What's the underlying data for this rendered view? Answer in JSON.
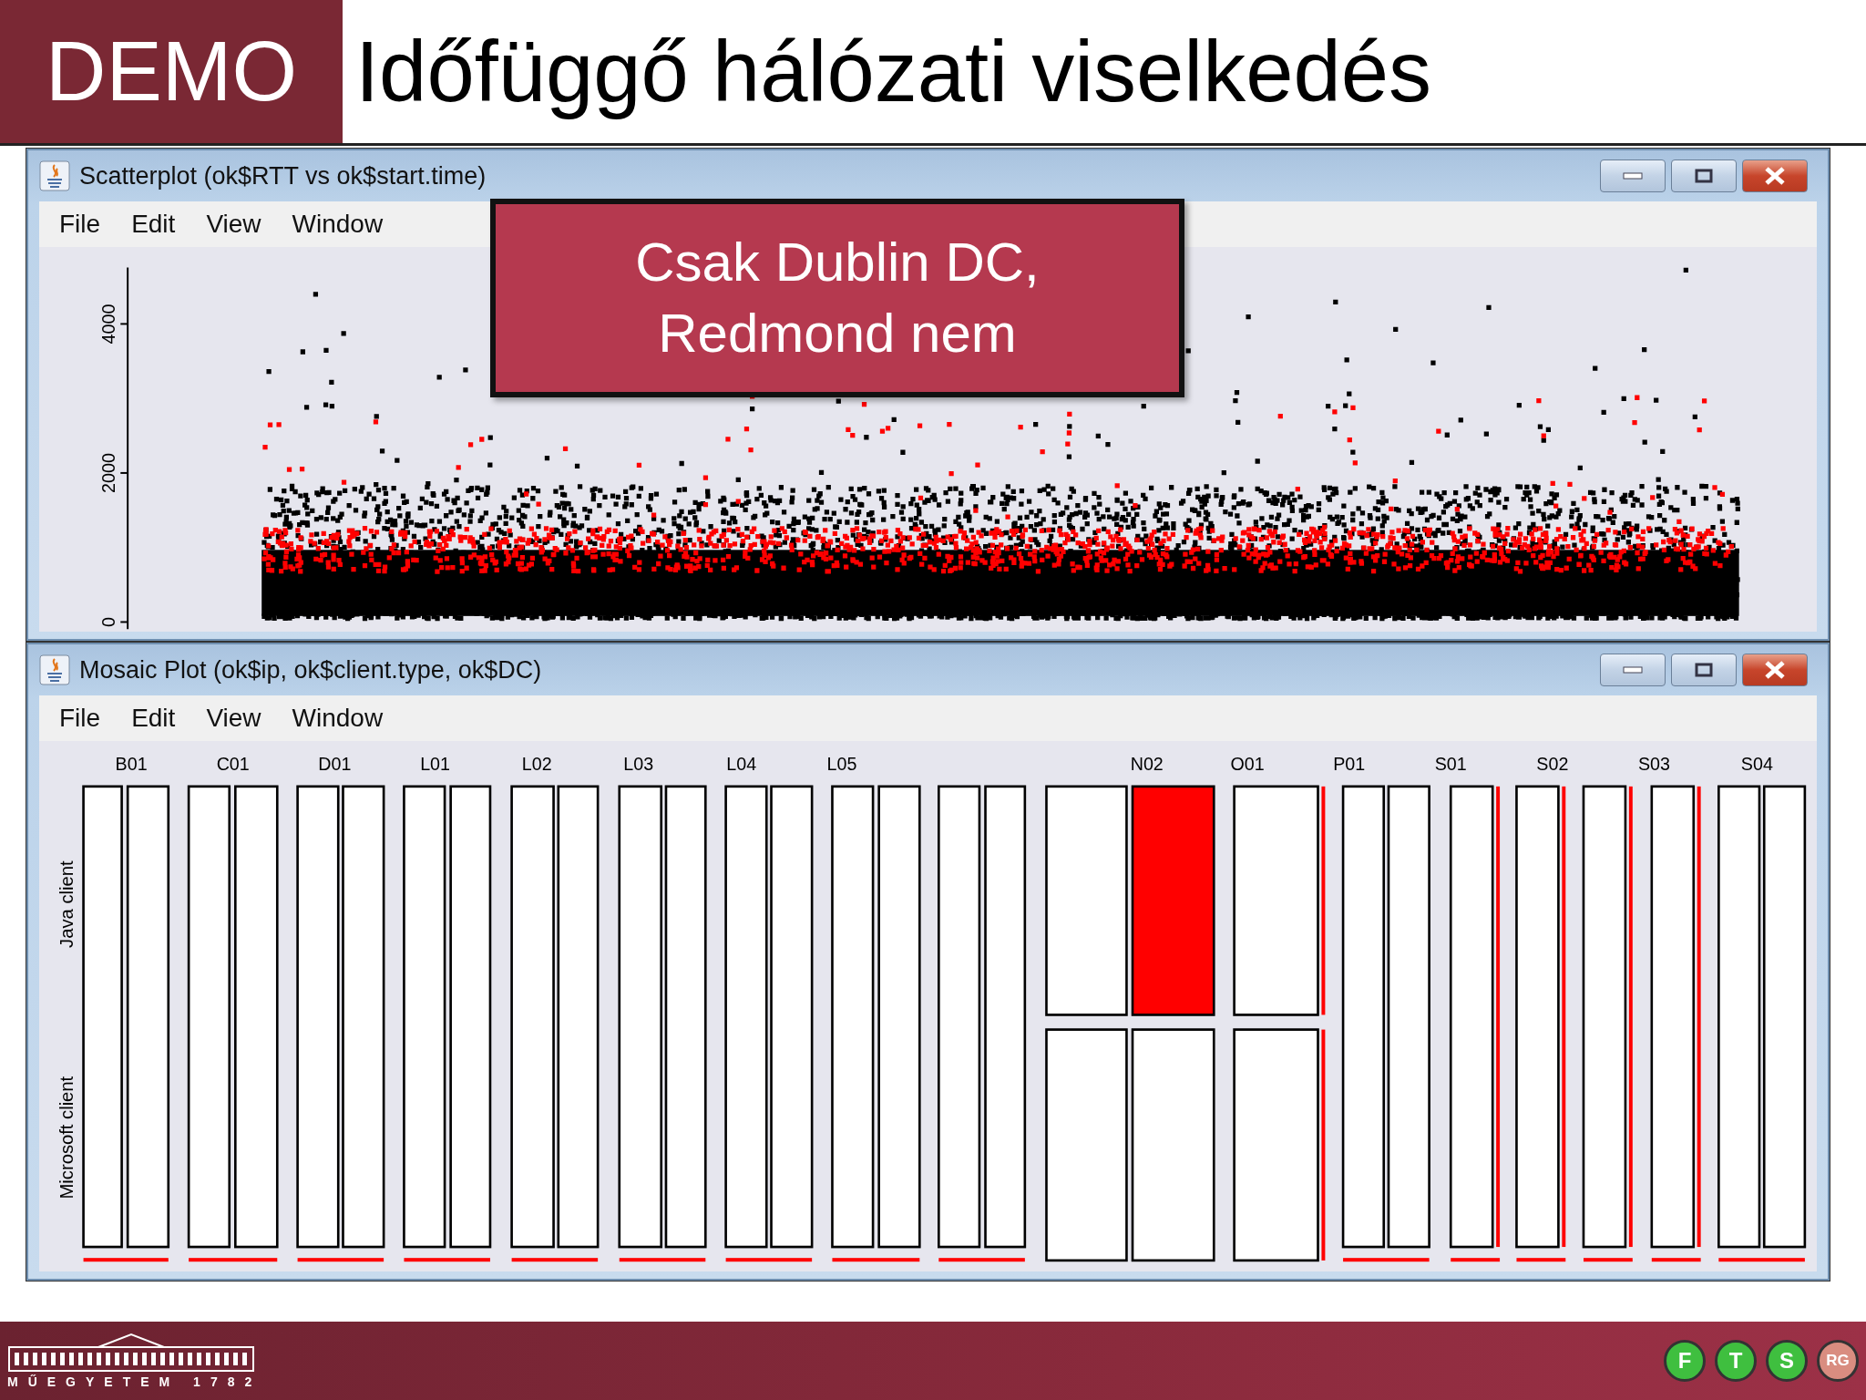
{
  "slide": {
    "badge": "DEMO",
    "title": "Időfüggő hálózati viselkedés"
  },
  "windows": [
    {
      "kind": "scatter",
      "title": "Scatterplot (ok$RTT vs ok$start.time)",
      "menu": [
        "File",
        "Edit",
        "View",
        "Window"
      ],
      "y_ticks": [
        "0",
        "2000",
        "4000"
      ]
    },
    {
      "kind": "mosaic",
      "title": "Mosaic Plot (ok$ip, ok$client.type, ok$DC)",
      "menu": [
        "File",
        "Edit",
        "View",
        "Window"
      ],
      "row_labels": [
        "Java client",
        "Microsoft client"
      ],
      "column_labels": [
        "B01",
        "C01",
        "D01",
        "L01",
        "L02",
        "L03",
        "L04",
        "L05",
        "N02",
        "O01",
        "P01",
        "S01",
        "S02",
        "S03",
        "S04"
      ]
    }
  ],
  "callout": {
    "lines": [
      "Csak Dublin DC,",
      "Redmond nem"
    ]
  },
  "footer": {
    "university": "MŰEGYETEM 1782",
    "group_letters": [
      "F",
      "T",
      "S",
      "RG"
    ]
  }
}
